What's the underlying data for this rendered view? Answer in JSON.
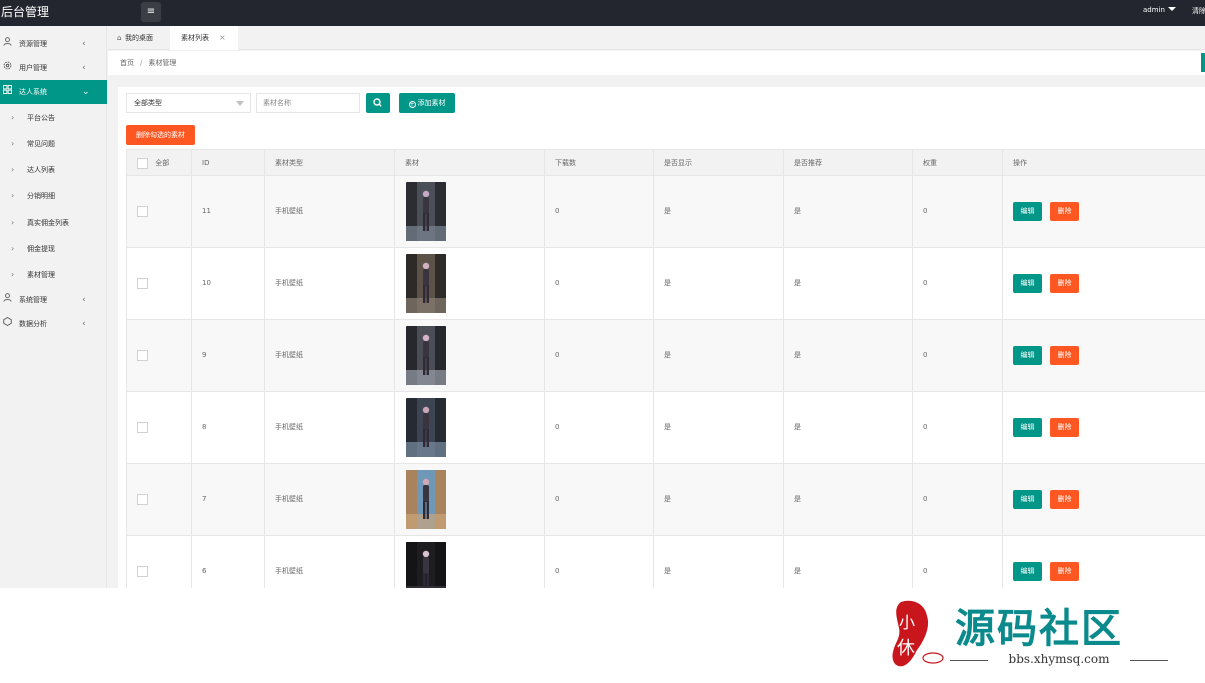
{
  "header": {
    "logo": "后台管理",
    "user": "admin",
    "clear_cache": "清除缓存"
  },
  "sidebar": {
    "groups": [
      {
        "label": "资源管理",
        "icon": "user-icon"
      },
      {
        "label": "用户管理",
        "icon": "gear-icon"
      },
      {
        "label": "达人系统",
        "icon": "grid-icon",
        "active": true
      },
      {
        "label": "系统管理",
        "icon": "user-icon"
      },
      {
        "label": "数据分析",
        "icon": "settings-icon"
      }
    ],
    "sub_items": [
      {
        "label": "平台公告"
      },
      {
        "label": "常见问题"
      },
      {
        "label": "达人列表"
      },
      {
        "label": "分销明细"
      },
      {
        "label": "真实佣金列表"
      },
      {
        "label": "佣金提现"
      },
      {
        "label": "素材管理"
      }
    ]
  },
  "tabs": [
    {
      "label": "我的桌面"
    },
    {
      "label": "素材列表",
      "active": true
    }
  ],
  "breadcrumb": {
    "home": "首页",
    "separator": "/",
    "current": "素材管理"
  },
  "filters": {
    "type_select": "全部类型",
    "name_placeholder": "素材名称",
    "add_label": "添加素材",
    "delete_selected_label": "删除勾选的素材"
  },
  "table": {
    "headers": {
      "select_all": "全部",
      "id": "ID",
      "type": "素材类型",
      "material": "素材",
      "downloads": "下载数",
      "show": "是否显示",
      "recommend": "是否推荐",
      "weight": "权重",
      "actions": "操作"
    },
    "rows": [
      {
        "id": "11",
        "type": "手机壁纸",
        "downloads": "0",
        "show": "是",
        "recommend": "是",
        "weight": "0",
        "edit": "编辑",
        "delete": "删除"
      },
      {
        "id": "10",
        "type": "手机壁纸",
        "downloads": "0",
        "show": "是",
        "recommend": "是",
        "weight": "0",
        "edit": "编辑",
        "delete": "删除"
      },
      {
        "id": "9",
        "type": "手机壁纸",
        "downloads": "0",
        "show": "是",
        "recommend": "是",
        "weight": "0",
        "edit": "编辑",
        "delete": "删除"
      },
      {
        "id": "8",
        "type": "手机壁纸",
        "downloads": "0",
        "show": "是",
        "recommend": "是",
        "weight": "0",
        "edit": "编辑",
        "delete": "删除"
      },
      {
        "id": "7",
        "type": "手机壁纸",
        "downloads": "0",
        "show": "是",
        "recommend": "是",
        "weight": "0",
        "edit": "编辑",
        "delete": "删除"
      },
      {
        "id": "6",
        "type": "手机壁纸",
        "downloads": "0",
        "show": "是",
        "recommend": "是",
        "weight": "0",
        "edit": "编辑",
        "delete": "删除"
      }
    ]
  },
  "watermark": {
    "title": "源码社区",
    "url": "bbs.xhymsq.com",
    "seal_text": "小休"
  },
  "colors": {
    "primary": "#009688",
    "danger": "#ff5722",
    "header_bg": "#23262e",
    "watermark": "#0a8a8c"
  }
}
